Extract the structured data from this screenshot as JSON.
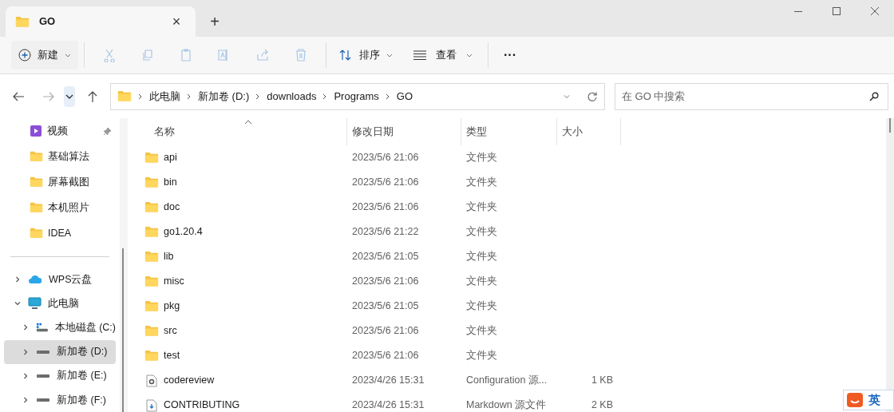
{
  "tab": {
    "title": "GO",
    "close": "×",
    "new": "+"
  },
  "toolbar": {
    "new": "新建",
    "sort": "排序",
    "view": "查看",
    "more": "···"
  },
  "address": {
    "crumbs": [
      "此电脑",
      "新加卷 (D:)",
      "downloads",
      "Programs",
      "GO"
    ],
    "search_placeholder": "在 GO 中搜索"
  },
  "sidebar": {
    "quick": [
      {
        "label": "视频",
        "kind": "video",
        "pinned": true
      },
      {
        "label": "基础算法",
        "kind": "folder",
        "pinned": false
      },
      {
        "label": "屏幕截图",
        "kind": "folder",
        "pinned": false
      },
      {
        "label": "本机照片",
        "kind": "folder",
        "pinned": false
      },
      {
        "label": "IDEA",
        "kind": "folder",
        "pinned": false
      }
    ],
    "tree": [
      {
        "label": "WPS云盘",
        "kind": "cloud",
        "expanded": false,
        "selected": false
      },
      {
        "label": "此电脑",
        "kind": "pc",
        "expanded": true,
        "selected": false,
        "children": [
          {
            "label": "本地磁盘 (C:)",
            "kind": "sysdrive",
            "expanded": false,
            "selected": false
          },
          {
            "label": "新加卷 (D:)",
            "kind": "drive",
            "expanded": false,
            "selected": true
          },
          {
            "label": "新加卷 (E:)",
            "kind": "drive",
            "expanded": false,
            "selected": false
          },
          {
            "label": "新加卷 (F:)",
            "kind": "drive",
            "expanded": false,
            "selected": false
          }
        ]
      }
    ]
  },
  "table": {
    "columns": [
      "名称",
      "修改日期",
      "类型",
      "大小"
    ],
    "rows": [
      {
        "name": "api",
        "date": "2023/5/6 21:06",
        "type": "文件夹",
        "size": "",
        "kind": "folder"
      },
      {
        "name": "bin",
        "date": "2023/5/6 21:06",
        "type": "文件夹",
        "size": "",
        "kind": "folder"
      },
      {
        "name": "doc",
        "date": "2023/5/6 21:06",
        "type": "文件夹",
        "size": "",
        "kind": "folder"
      },
      {
        "name": "go1.20.4",
        "date": "2023/5/6 21:22",
        "type": "文件夹",
        "size": "",
        "kind": "folder"
      },
      {
        "name": "lib",
        "date": "2023/5/6 21:05",
        "type": "文件夹",
        "size": "",
        "kind": "folder"
      },
      {
        "name": "misc",
        "date": "2023/5/6 21:06",
        "type": "文件夹",
        "size": "",
        "kind": "folder"
      },
      {
        "name": "pkg",
        "date": "2023/5/6 21:05",
        "type": "文件夹",
        "size": "",
        "kind": "folder"
      },
      {
        "name": "src",
        "date": "2023/5/6 21:06",
        "type": "文件夹",
        "size": "",
        "kind": "folder"
      },
      {
        "name": "test",
        "date": "2023/5/6 21:06",
        "type": "文件夹",
        "size": "",
        "kind": "folder"
      },
      {
        "name": "codereview",
        "date": "2023/4/26 15:31",
        "type": "Configuration 源...",
        "size": "1 KB",
        "kind": "config"
      },
      {
        "name": "CONTRIBUTING",
        "date": "2023/4/26 15:31",
        "type": "Markdown 源文件",
        "size": "2 KB",
        "kind": "markdown"
      }
    ]
  },
  "ime": {
    "mode": "英"
  }
}
